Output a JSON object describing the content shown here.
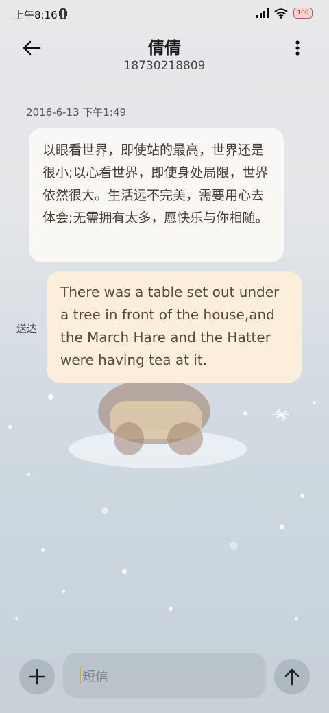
{
  "status_bar": {
    "time": "上午8:16",
    "battery": "100"
  },
  "header": {
    "contact_name": "倩倩",
    "contact_number": "18730218809",
    "back_icon": "arrow-left-icon",
    "more_icon": "more-vertical-icon"
  },
  "conversation": {
    "timestamp": "2016-6-13 下午1:49",
    "messages": [
      {
        "direction": "incoming",
        "text": "以眼看世界，即使站的最高，世界还是很小;以心看世界，即使身处局限，世界依然很大。生活远不完美，需要用心去体会;无需拥有太多，愿快乐与你相随。"
      },
      {
        "direction": "outgoing",
        "text": "There was a table set out under a tree in front of the house,and the March Hare and the Hatter were having tea at it.",
        "status": "送达"
      }
    ]
  },
  "composer": {
    "placeholder": "短信",
    "add_icon": "plus-icon",
    "send_icon": "arrow-up-icon"
  }
}
